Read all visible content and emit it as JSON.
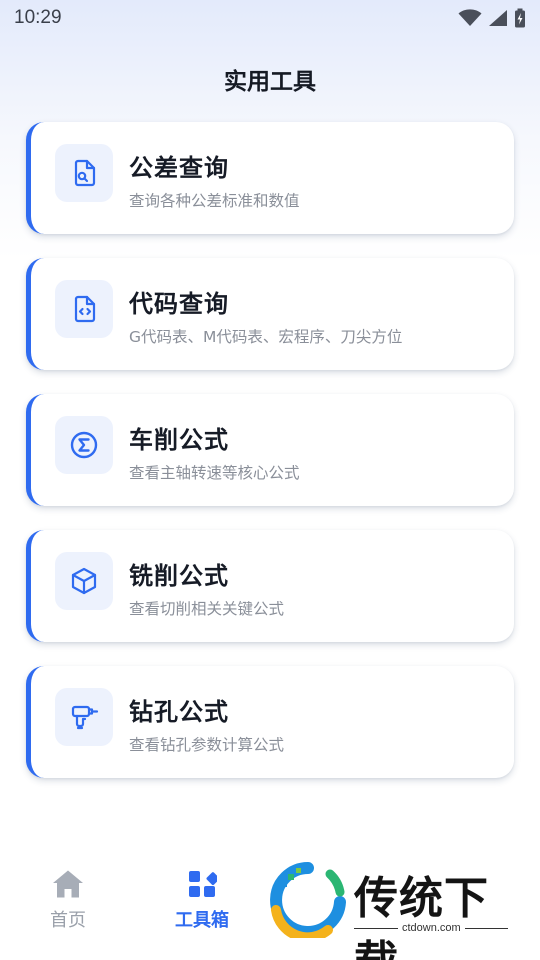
{
  "status_bar": {
    "time": "10:29"
  },
  "page": {
    "title": "实用工具"
  },
  "cards": [
    {
      "title": "公差查询",
      "desc": "查询各种公差标准和数值",
      "icon": "document-search-icon"
    },
    {
      "title": "代码查询",
      "desc": "G代码表、M代码表、宏程序、刀尖方位",
      "icon": "code-file-icon"
    },
    {
      "title": "车削公式",
      "desc": "查看主轴转速等核心公式",
      "icon": "sigma-icon"
    },
    {
      "title": "铣削公式",
      "desc": "查看切削相关关键公式",
      "icon": "cube-icon"
    },
    {
      "title": "钻孔公式",
      "desc": "查看钻孔参数计算公式",
      "icon": "drill-icon"
    }
  ],
  "bottom_nav": {
    "home_label": "首页",
    "tools_label": "工具箱"
  },
  "watermark": {
    "name": "传统下载",
    "url": "ctdown.com"
  },
  "colors": {
    "accent": "#2f6bf0",
    "icon_bg": "#edf2fd",
    "inactive": "#9aa0aa"
  }
}
